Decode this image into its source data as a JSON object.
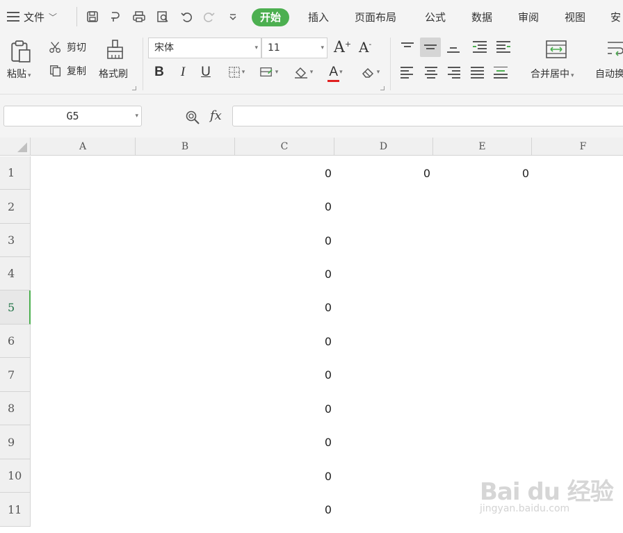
{
  "menubar": {
    "file_label": "文件",
    "tabs": [
      {
        "label": "开始"
      },
      {
        "label": "插入"
      },
      {
        "label": "页面布局"
      },
      {
        "label": "公式"
      },
      {
        "label": "数据"
      },
      {
        "label": "审阅"
      },
      {
        "label": "视图"
      },
      {
        "label": "安"
      }
    ],
    "active_tab": "开始",
    "accent_color": "#4caf50"
  },
  "ribbon": {
    "paste_label": "粘贴",
    "cut_label": "剪切",
    "copy_label": "复制",
    "format_painter_label": "格式刷",
    "font_name": "宋体",
    "font_size": "11",
    "bold": "B",
    "italic": "I",
    "underline": "U",
    "increase_font": "A",
    "decrease_font": "A",
    "font_color_letter": "A",
    "merge_label": "合并居中",
    "wrap_label": "自动换"
  },
  "formula_bar": {
    "name_box": "G5",
    "fx_label": "fx",
    "formula": ""
  },
  "sheet": {
    "columns": [
      "A",
      "B",
      "C",
      "D",
      "E",
      "F"
    ],
    "rows": [
      "1",
      "2",
      "3",
      "4",
      "5",
      "6",
      "7",
      "8",
      "9",
      "10",
      "11"
    ],
    "active_row": "5",
    "cells": {
      "C1": "0",
      "D1": "0",
      "E1": "0",
      "C2": "0",
      "C3": "0",
      "C4": "0",
      "C5": "0",
      "C6": "0",
      "C7": "0",
      "C8": "0",
      "C9": "0",
      "C10": "0",
      "C11": "0"
    }
  },
  "watermark": {
    "line1": "Bai du 经验",
    "line2": "jingyan.baidu.com"
  }
}
